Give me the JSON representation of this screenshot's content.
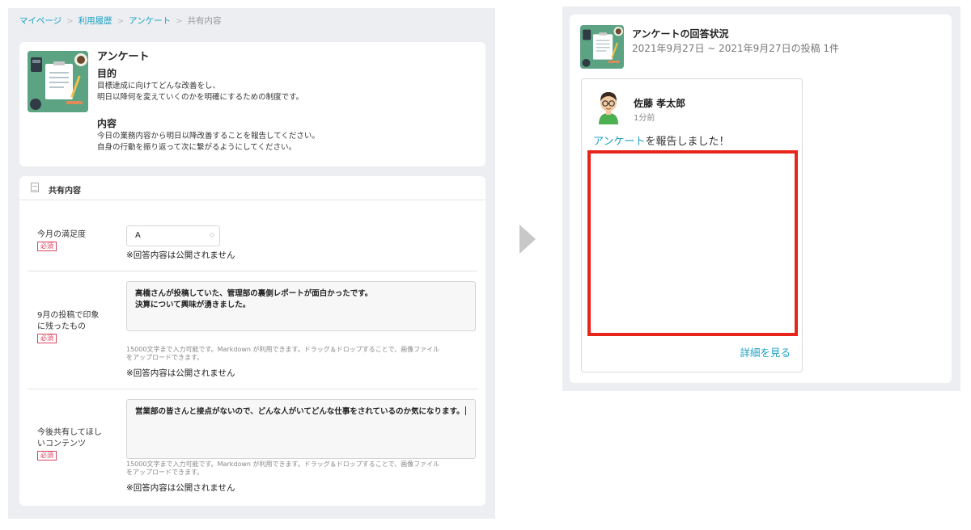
{
  "breadcrumb": {
    "items": [
      "マイページ",
      "利用履歴",
      "アンケート",
      "共有内容"
    ],
    "separator": ">"
  },
  "survey": {
    "title": "アンケート",
    "purpose_title": "目的",
    "purpose_lines": [
      "目標達成に向けてどんな改善をし、",
      "明日以降何を変えていくのかを明確にするための制度です。"
    ],
    "content_title": "内容",
    "content_lines": [
      "今日の業務内容から明日以降改善することを報告してください。",
      "自身の行動を振り返って次に繋がるようにしてください。"
    ]
  },
  "form": {
    "header": "共有内容",
    "required_label": "必須",
    "notice": "※回答内容は公開されません",
    "hint_lines": [
      "15000文字まで入力可能です。Markdown が利用できます。ドラッグ＆ドロップすることで、画像ファイル",
      "をアップロードできます。"
    ],
    "fields": [
      {
        "label_lines": [
          "今月の満足度"
        ],
        "value": "A"
      },
      {
        "label_lines": [
          "9月の投稿で印象",
          "に残ったもの"
        ],
        "value_lines": [
          "高橋さんが投稿していた、管理部の裏側レポートが面白かったです。",
          "決算について興味が湧きました。"
        ]
      },
      {
        "label_lines": [
          "今後共有してほし",
          "いコンテンツ"
        ],
        "value_lines": [
          "営業部の皆さんと接点がないので、どんな人がいてどんな仕事をされているのか気になります。"
        ]
      }
    ]
  },
  "status": {
    "title": "アンケートの回答状況",
    "subtitle": "2021年9月27日 ~ 2021年9月27日の投稿 1件"
  },
  "post": {
    "author": "佐藤 孝太郎",
    "time": "1分前",
    "message_link": "アンケート",
    "message_rest": "を報告しました！",
    "detail_link": "詳細を見る"
  },
  "colors": {
    "accent": "#1aa2c4",
    "required": "#d9455f",
    "highlight": "#e8251b",
    "thumbnail": "#5ca383",
    "panel_bg": "#eceef1"
  },
  "icons": {
    "survey_thumbnail": "survey-clipboard-illustration",
    "form_header": "document-icon",
    "select": "chevron-down-icon",
    "transition": "arrow-right-icon",
    "avatar": "user-avatar-illustration"
  }
}
